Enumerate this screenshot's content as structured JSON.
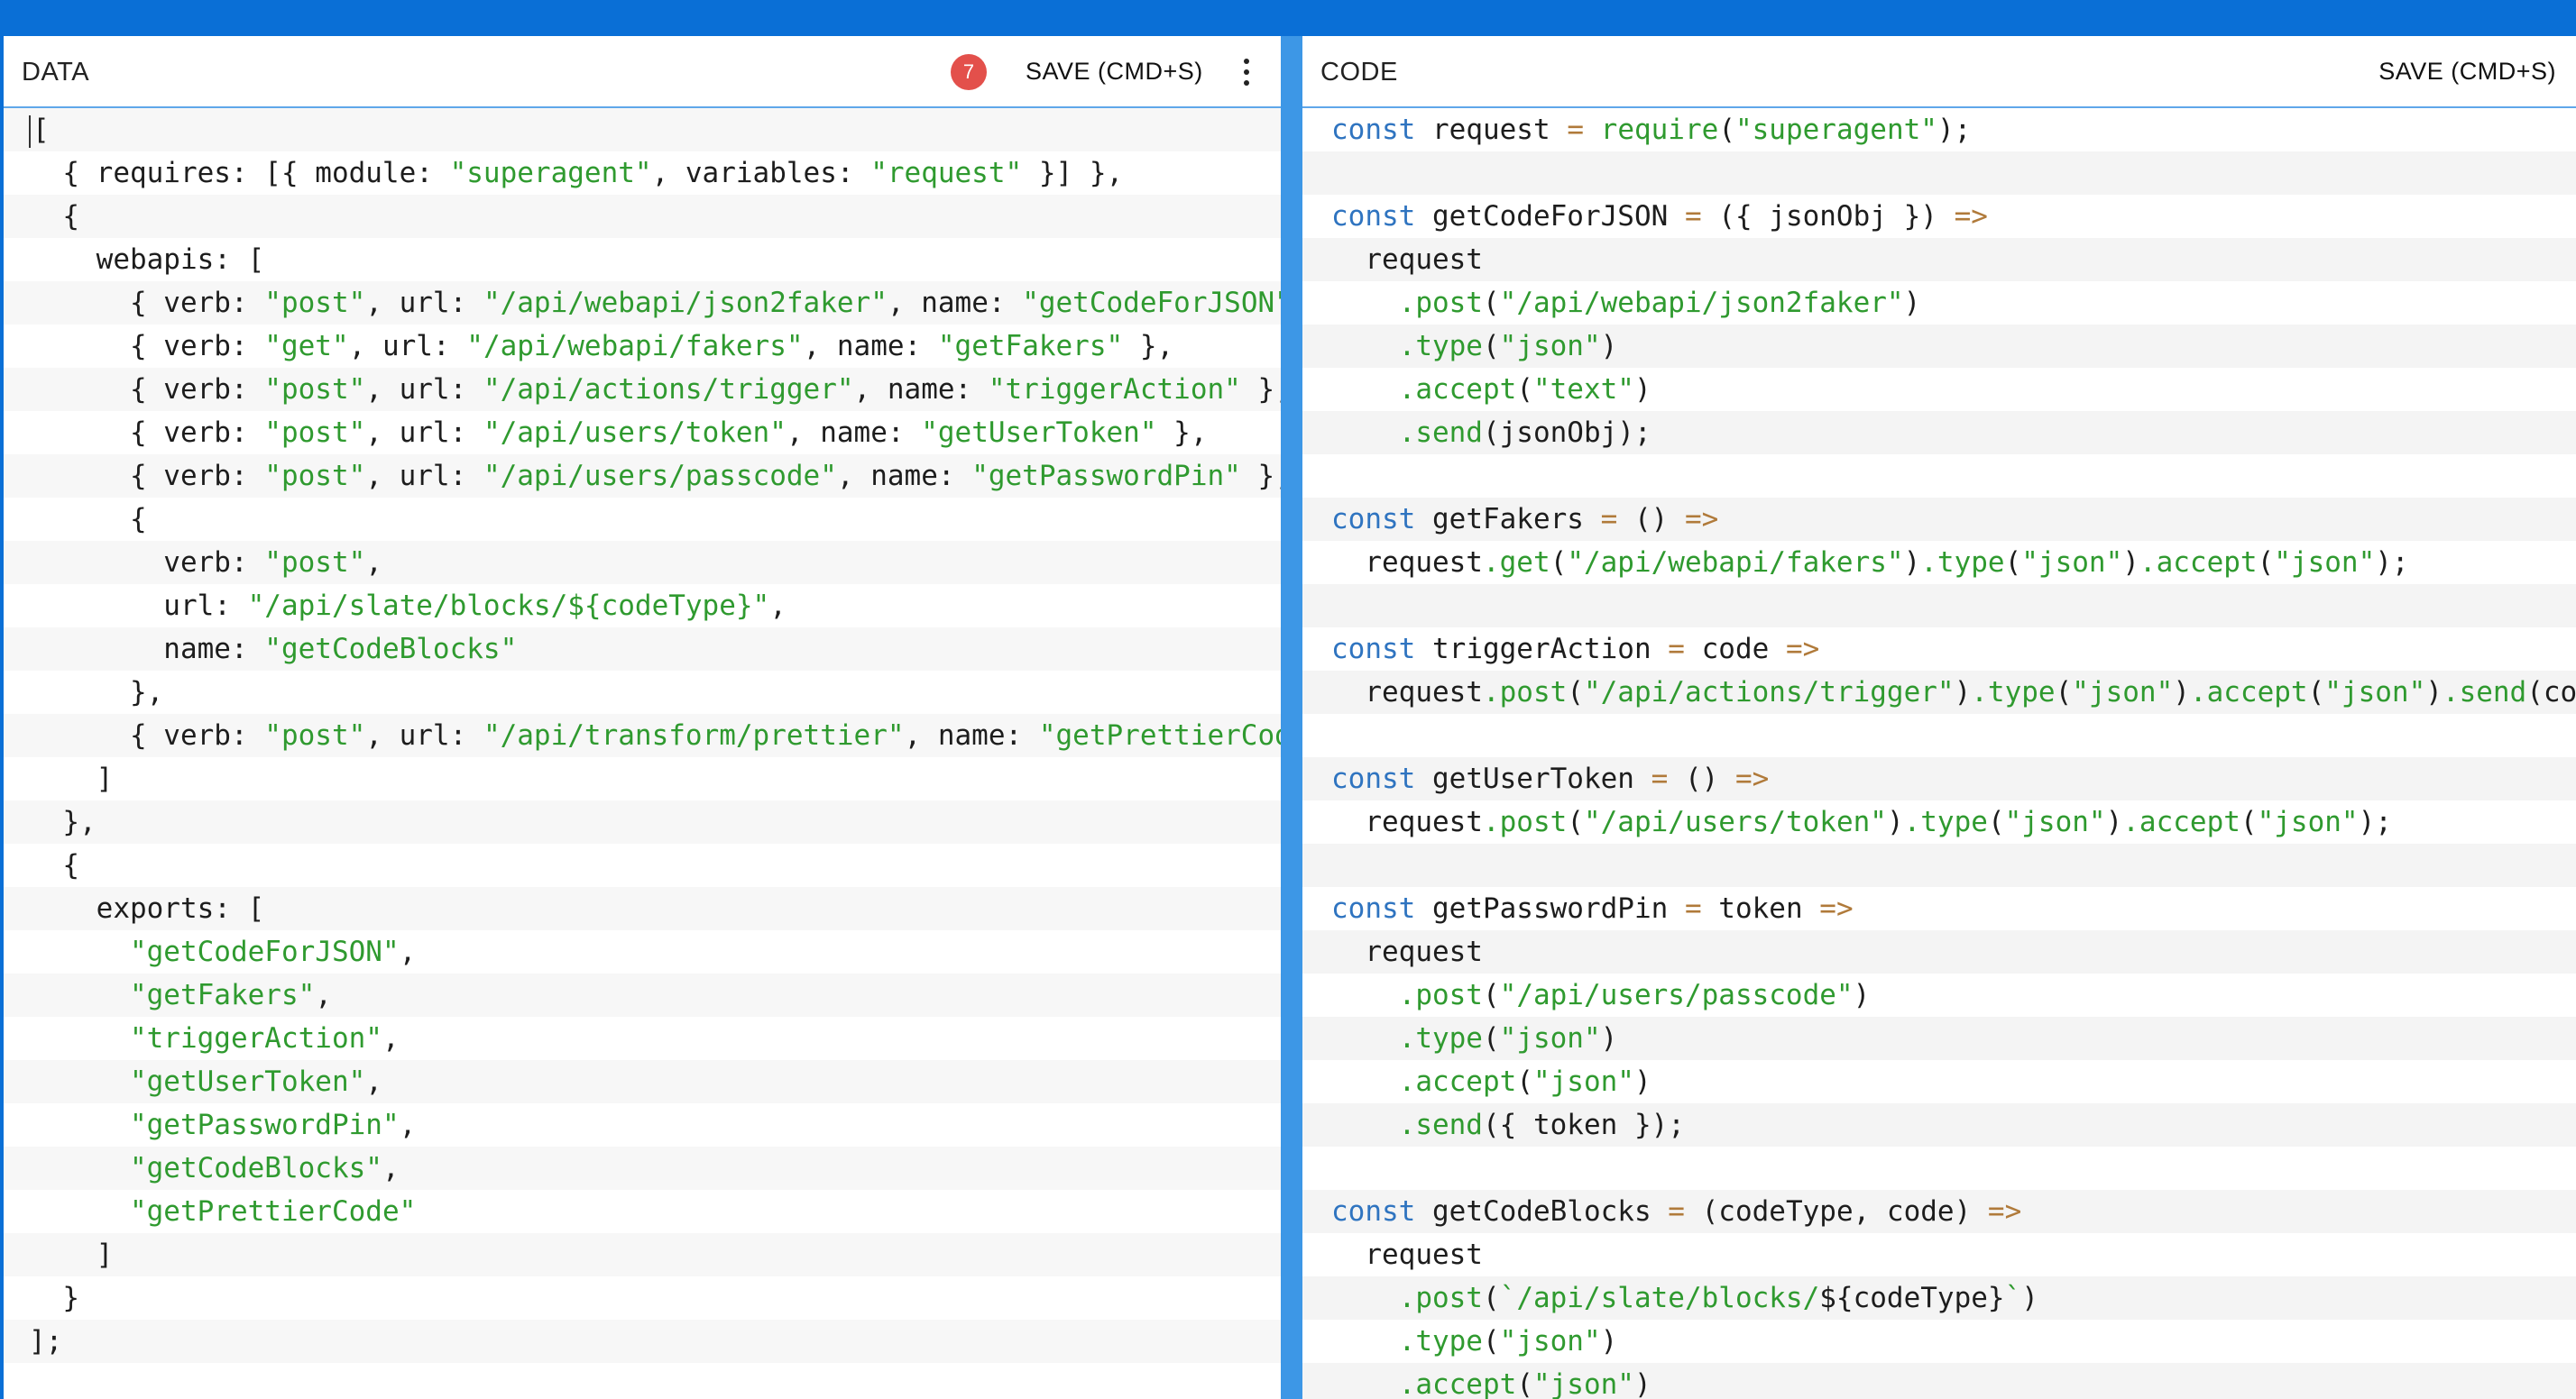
{
  "data_pane": {
    "title": "DATA",
    "badge_count": "7",
    "save_label": "SAVE (CMD+S)",
    "lines": [
      [
        [
          "t",
          "["
        ]
      ],
      [
        [
          "t",
          "  { requires: [{ module: "
        ],
        [
          "s",
          "\"superagent\""
        ],
        [
          "t",
          ", variables: "
        ],
        [
          "s",
          "\"request\""
        ],
        [
          "t",
          " }] },"
        ]
      ],
      [
        [
          "t",
          "  {"
        ]
      ],
      [
        [
          "t",
          "    webapis: ["
        ]
      ],
      [
        [
          "t",
          "      { verb: "
        ],
        [
          "s",
          "\"post\""
        ],
        [
          "t",
          ", url: "
        ],
        [
          "s",
          "\"/api/webapi/json2faker\""
        ],
        [
          "t",
          ", name: "
        ],
        [
          "s",
          "\"getCodeForJSON\""
        ],
        [
          "t",
          " },"
        ]
      ],
      [
        [
          "t",
          "      { verb: "
        ],
        [
          "s",
          "\"get\""
        ],
        [
          "t",
          ", url: "
        ],
        [
          "s",
          "\"/api/webapi/fakers\""
        ],
        [
          "t",
          ", name: "
        ],
        [
          "s",
          "\"getFakers\""
        ],
        [
          "t",
          " },"
        ]
      ],
      [
        [
          "t",
          "      { verb: "
        ],
        [
          "s",
          "\"post\""
        ],
        [
          "t",
          ", url: "
        ],
        [
          "s",
          "\"/api/actions/trigger\""
        ],
        [
          "t",
          ", name: "
        ],
        [
          "s",
          "\"triggerAction\""
        ],
        [
          "t",
          " },"
        ]
      ],
      [
        [
          "t",
          "      { verb: "
        ],
        [
          "s",
          "\"post\""
        ],
        [
          "t",
          ", url: "
        ],
        [
          "s",
          "\"/api/users/token\""
        ],
        [
          "t",
          ", name: "
        ],
        [
          "s",
          "\"getUserToken\""
        ],
        [
          "t",
          " },"
        ]
      ],
      [
        [
          "t",
          "      { verb: "
        ],
        [
          "s",
          "\"post\""
        ],
        [
          "t",
          ", url: "
        ],
        [
          "s",
          "\"/api/users/passcode\""
        ],
        [
          "t",
          ", name: "
        ],
        [
          "s",
          "\"getPasswordPin\""
        ],
        [
          "t",
          " },"
        ]
      ],
      [
        [
          "t",
          "      {"
        ]
      ],
      [
        [
          "t",
          "        verb: "
        ],
        [
          "s",
          "\"post\""
        ],
        [
          "t",
          ","
        ]
      ],
      [
        [
          "t",
          "        url: "
        ],
        [
          "s",
          "\"/api/slate/blocks/${codeType}\""
        ],
        [
          "t",
          ","
        ]
      ],
      [
        [
          "t",
          "        name: "
        ],
        [
          "s",
          "\"getCodeBlocks\""
        ]
      ],
      [
        [
          "t",
          "      },"
        ]
      ],
      [
        [
          "t",
          "      { verb: "
        ],
        [
          "s",
          "\"post\""
        ],
        [
          "t",
          ", url: "
        ],
        [
          "s",
          "\"/api/transform/prettier\""
        ],
        [
          "t",
          ", name: "
        ],
        [
          "s",
          "\"getPrettierCode\""
        ],
        [
          "t",
          " }"
        ]
      ],
      [
        [
          "t",
          "    ]"
        ]
      ],
      [
        [
          "t",
          "  },"
        ]
      ],
      [
        [
          "t",
          "  {"
        ]
      ],
      [
        [
          "t",
          "    exports: ["
        ]
      ],
      [
        [
          "t",
          "      "
        ],
        [
          "s",
          "\"getCodeForJSON\""
        ],
        [
          "t",
          ","
        ]
      ],
      [
        [
          "t",
          "      "
        ],
        [
          "s",
          "\"getFakers\""
        ],
        [
          "t",
          ","
        ]
      ],
      [
        [
          "t",
          "      "
        ],
        [
          "s",
          "\"triggerAction\""
        ],
        [
          "t",
          ","
        ]
      ],
      [
        [
          "t",
          "      "
        ],
        [
          "s",
          "\"getUserToken\""
        ],
        [
          "t",
          ","
        ]
      ],
      [
        [
          "t",
          "      "
        ],
        [
          "s",
          "\"getPasswordPin\""
        ],
        [
          "t",
          ","
        ]
      ],
      [
        [
          "t",
          "      "
        ],
        [
          "s",
          "\"getCodeBlocks\""
        ],
        [
          "t",
          ","
        ]
      ],
      [
        [
          "t",
          "      "
        ],
        [
          "s",
          "\"getPrettierCode\""
        ]
      ],
      [
        [
          "t",
          "    ]"
        ]
      ],
      [
        [
          "t",
          "  }"
        ]
      ],
      [
        [
          "t",
          "];"
        ]
      ]
    ]
  },
  "code_pane": {
    "title": "CODE",
    "save_label": "SAVE (CMD+S)",
    "lines": [
      [
        [
          "k",
          "const"
        ],
        [
          "t",
          " request "
        ],
        [
          "p",
          "="
        ],
        [
          "t",
          " "
        ],
        [
          "m",
          "require"
        ],
        [
          "t",
          "("
        ],
        [
          "s",
          "\"superagent\""
        ],
        [
          "t",
          ");"
        ]
      ],
      [],
      [
        [
          "k",
          "const"
        ],
        [
          "t",
          " getCodeForJSON "
        ],
        [
          "p",
          "="
        ],
        [
          "t",
          " ({ jsonObj }) "
        ],
        [
          "p",
          "=>"
        ]
      ],
      [
        [
          "t",
          "  request"
        ]
      ],
      [
        [
          "t",
          "    "
        ],
        [
          "m",
          ".post"
        ],
        [
          "t",
          "("
        ],
        [
          "s",
          "\"/api/webapi/json2faker\""
        ],
        [
          "t",
          ")"
        ]
      ],
      [
        [
          "t",
          "    "
        ],
        [
          "m",
          ".type"
        ],
        [
          "t",
          "("
        ],
        [
          "s",
          "\"json\""
        ],
        [
          "t",
          ")"
        ]
      ],
      [
        [
          "t",
          "    "
        ],
        [
          "m",
          ".accept"
        ],
        [
          "t",
          "("
        ],
        [
          "s",
          "\"text\""
        ],
        [
          "t",
          ")"
        ]
      ],
      [
        [
          "t",
          "    "
        ],
        [
          "m",
          ".send"
        ],
        [
          "t",
          "(jsonObj);"
        ]
      ],
      [],
      [
        [
          "k",
          "const"
        ],
        [
          "t",
          " getFakers "
        ],
        [
          "p",
          "="
        ],
        [
          "t",
          " () "
        ],
        [
          "p",
          "=>"
        ]
      ],
      [
        [
          "t",
          "  request"
        ],
        [
          "m",
          ".get"
        ],
        [
          "t",
          "("
        ],
        [
          "s",
          "\"/api/webapi/fakers\""
        ],
        [
          "t",
          ")"
        ],
        [
          "m",
          ".type"
        ],
        [
          "t",
          "("
        ],
        [
          "s",
          "\"json\""
        ],
        [
          "t",
          ")"
        ],
        [
          "m",
          ".accept"
        ],
        [
          "t",
          "("
        ],
        [
          "s",
          "\"json\""
        ],
        [
          "t",
          ");"
        ]
      ],
      [],
      [
        [
          "k",
          "const"
        ],
        [
          "t",
          " triggerAction "
        ],
        [
          "p",
          "="
        ],
        [
          "t",
          " code "
        ],
        [
          "p",
          "=>"
        ]
      ],
      [
        [
          "t",
          "  request"
        ],
        [
          "m",
          ".post"
        ],
        [
          "t",
          "("
        ],
        [
          "s",
          "\"/api/actions/trigger\""
        ],
        [
          "t",
          ")"
        ],
        [
          "m",
          ".type"
        ],
        [
          "t",
          "("
        ],
        [
          "s",
          "\"json\""
        ],
        [
          "t",
          ")"
        ],
        [
          "m",
          ".accept"
        ],
        [
          "t",
          "("
        ],
        [
          "s",
          "\"json\""
        ],
        [
          "t",
          ")"
        ],
        [
          "m",
          ".send"
        ],
        [
          "t",
          "(code);"
        ]
      ],
      [],
      [
        [
          "k",
          "const"
        ],
        [
          "t",
          " getUserToken "
        ],
        [
          "p",
          "="
        ],
        [
          "t",
          " () "
        ],
        [
          "p",
          "=>"
        ]
      ],
      [
        [
          "t",
          "  request"
        ],
        [
          "m",
          ".post"
        ],
        [
          "t",
          "("
        ],
        [
          "s",
          "\"/api/users/token\""
        ],
        [
          "t",
          ")"
        ],
        [
          "m",
          ".type"
        ],
        [
          "t",
          "("
        ],
        [
          "s",
          "\"json\""
        ],
        [
          "t",
          ")"
        ],
        [
          "m",
          ".accept"
        ],
        [
          "t",
          "("
        ],
        [
          "s",
          "\"json\""
        ],
        [
          "t",
          ");"
        ]
      ],
      [],
      [
        [
          "k",
          "const"
        ],
        [
          "t",
          " getPasswordPin "
        ],
        [
          "p",
          "="
        ],
        [
          "t",
          " token "
        ],
        [
          "p",
          "=>"
        ]
      ],
      [
        [
          "t",
          "  request"
        ]
      ],
      [
        [
          "t",
          "    "
        ],
        [
          "m",
          ".post"
        ],
        [
          "t",
          "("
        ],
        [
          "s",
          "\"/api/users/passcode\""
        ],
        [
          "t",
          ")"
        ]
      ],
      [
        [
          "t",
          "    "
        ],
        [
          "m",
          ".type"
        ],
        [
          "t",
          "("
        ],
        [
          "s",
          "\"json\""
        ],
        [
          "t",
          ")"
        ]
      ],
      [
        [
          "t",
          "    "
        ],
        [
          "m",
          ".accept"
        ],
        [
          "t",
          "("
        ],
        [
          "s",
          "\"json\""
        ],
        [
          "t",
          ")"
        ]
      ],
      [
        [
          "t",
          "    "
        ],
        [
          "m",
          ".send"
        ],
        [
          "t",
          "({ token });"
        ]
      ],
      [],
      [
        [
          "k",
          "const"
        ],
        [
          "t",
          " getCodeBlocks "
        ],
        [
          "p",
          "="
        ],
        [
          "t",
          " (codeType, code) "
        ],
        [
          "p",
          "=>"
        ]
      ],
      [
        [
          "t",
          "  request"
        ]
      ],
      [
        [
          "t",
          "    "
        ],
        [
          "m",
          ".post"
        ],
        [
          "t",
          "("
        ],
        [
          "s",
          "`/api/slate/blocks/"
        ],
        [
          "t",
          "${codeType}"
        ],
        [
          "s",
          "`"
        ],
        [
          "t",
          ")"
        ]
      ],
      [
        [
          "t",
          "    "
        ],
        [
          "m",
          ".type"
        ],
        [
          "t",
          "("
        ],
        [
          "s",
          "\"json\""
        ],
        [
          "t",
          ")"
        ]
      ],
      [
        [
          "t",
          "    "
        ],
        [
          "m",
          ".accept"
        ],
        [
          "t",
          "("
        ],
        [
          "s",
          "\"json\""
        ],
        [
          "t",
          ")"
        ]
      ]
    ]
  },
  "colors": {
    "top_bar": "#0a6fd6",
    "divider": "#3d97e6",
    "badge": "#e3504b",
    "keyword": "#2f74c0",
    "string": "#2f9a2f",
    "operator": "#b07a3a"
  }
}
